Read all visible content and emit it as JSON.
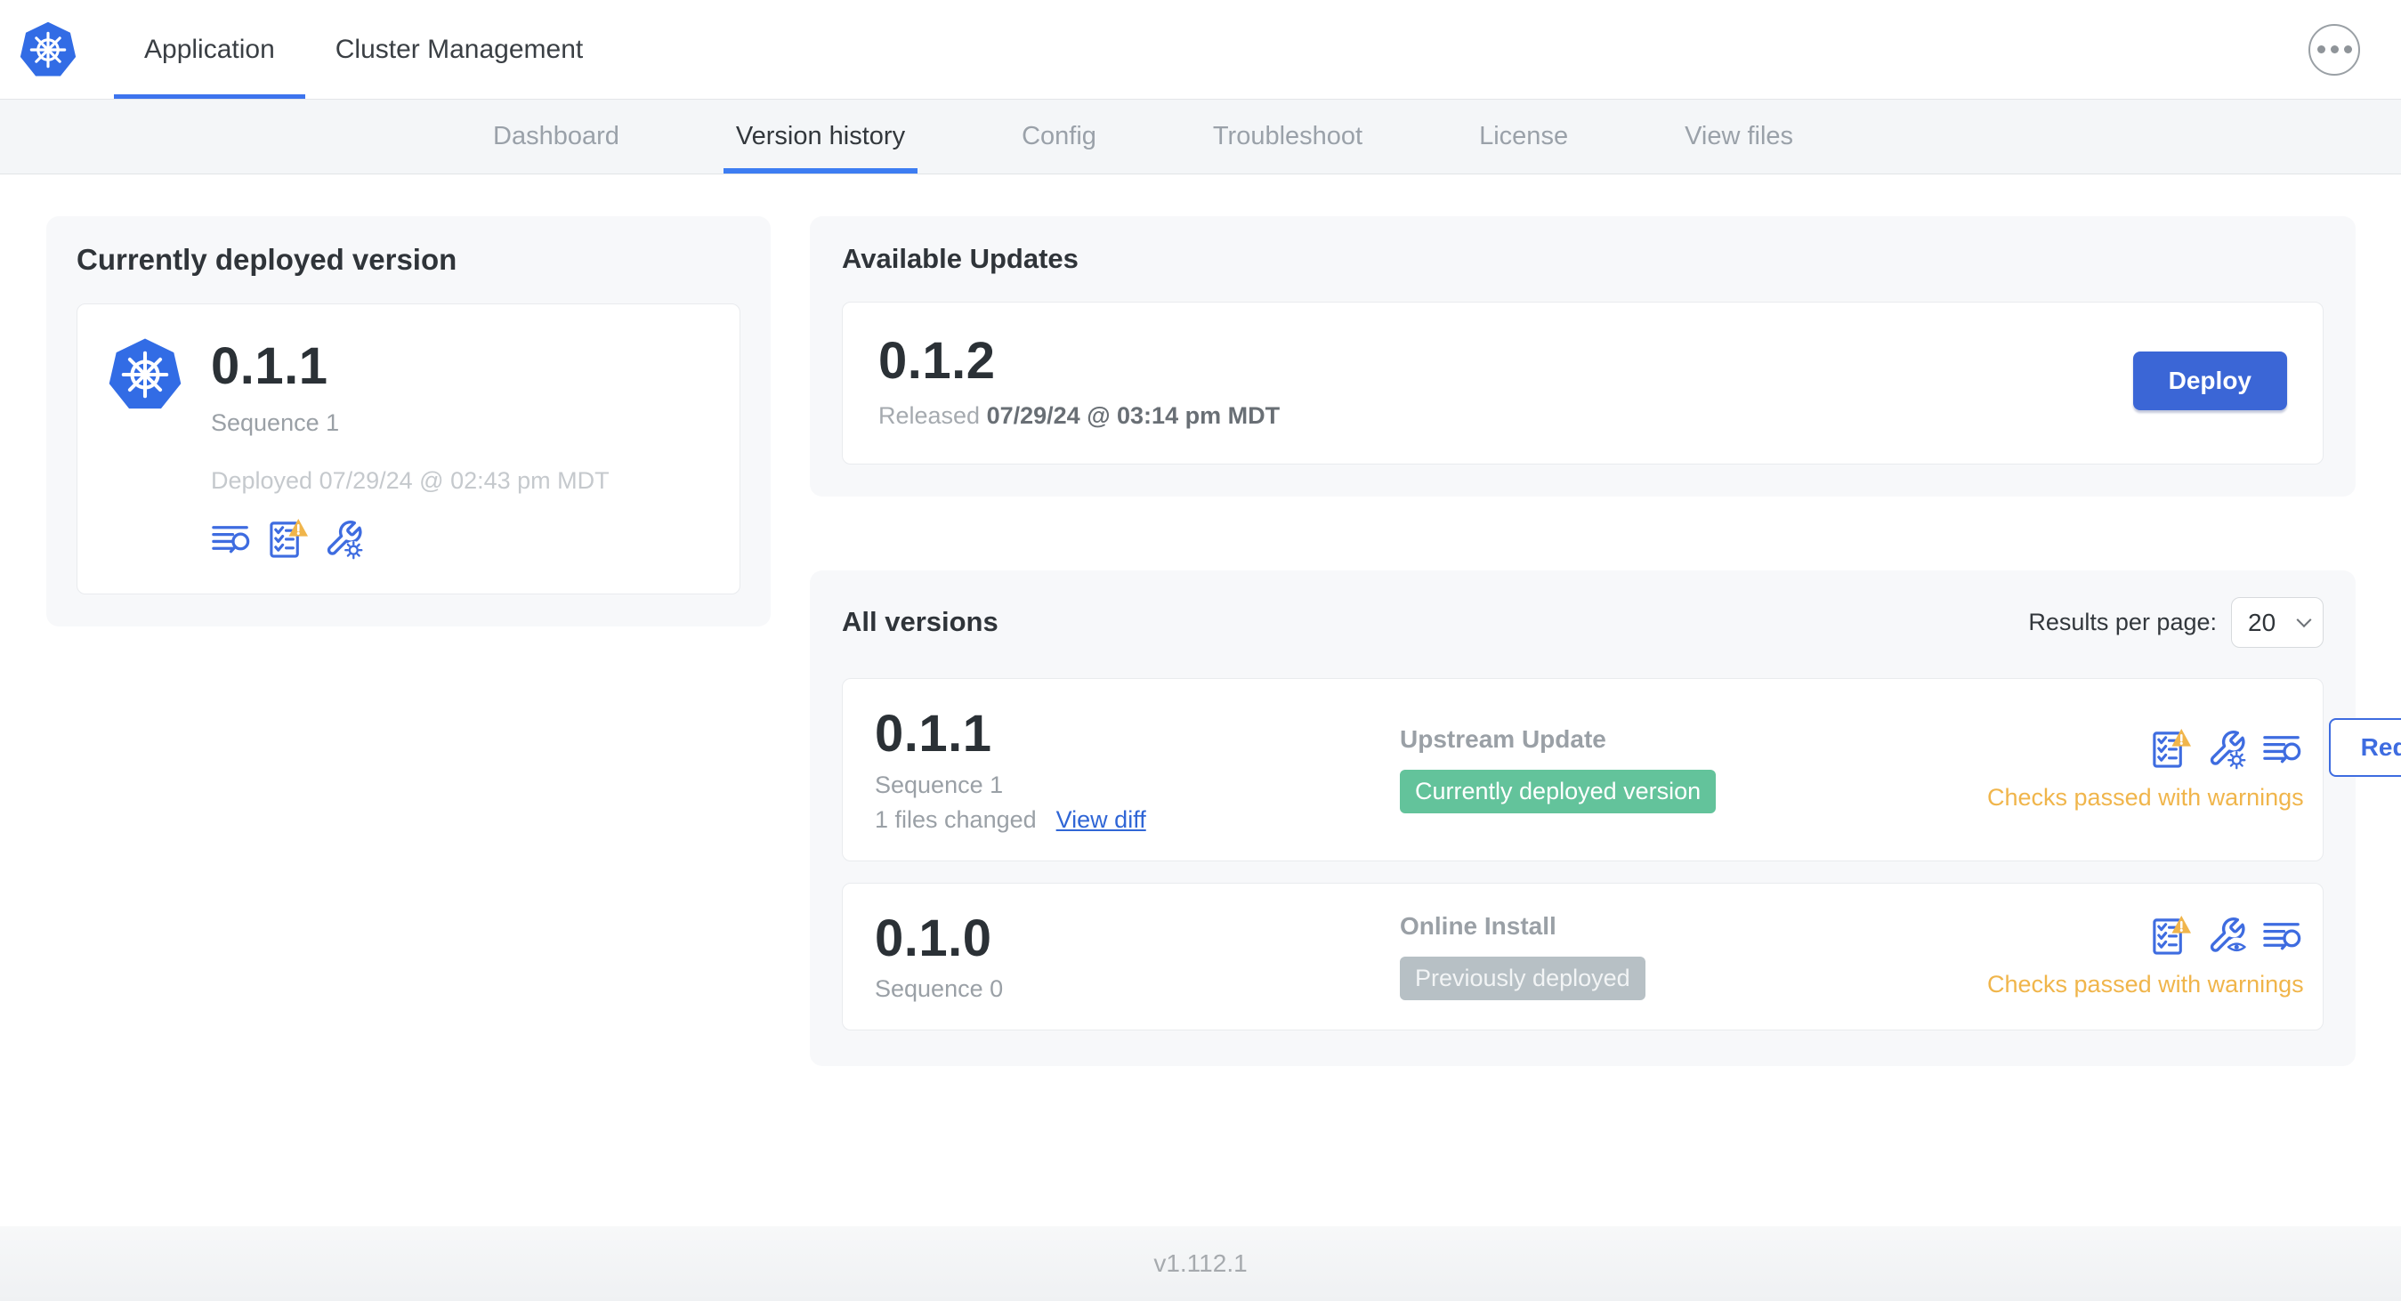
{
  "header": {
    "tabs": [
      {
        "label": "Application",
        "active": true
      },
      {
        "label": "Cluster Management",
        "active": false
      }
    ]
  },
  "subnav": {
    "tabs": [
      {
        "label": "Dashboard",
        "active": false
      },
      {
        "label": "Version history",
        "active": true
      },
      {
        "label": "Config",
        "active": false
      },
      {
        "label": "Troubleshoot",
        "active": false
      },
      {
        "label": "License",
        "active": false
      },
      {
        "label": "View files",
        "active": false
      }
    ]
  },
  "deployed_card": {
    "title": "Currently deployed version",
    "version": "0.1.1",
    "sequence": "Sequence 1",
    "deployed_at": "Deployed 07/29/24 @ 02:43 pm MDT",
    "icons": [
      "logs-search-icon",
      "preflight-checks-warning-icon",
      "config-edit-icon"
    ]
  },
  "available_updates": {
    "title": "Available Updates",
    "version": "0.1.2",
    "released_label": "Released",
    "released_at": "07/29/24 @ 03:14 pm MDT",
    "deploy_label": "Deploy"
  },
  "all_versions": {
    "title": "All versions",
    "results_per_page_label": "Results per page:",
    "results_per_page_value": "20",
    "rows": [
      {
        "version": "0.1.1",
        "sequence": "Sequence 1",
        "files_changed": "1 files changed",
        "view_diff_label": "View diff",
        "source": "Upstream Update",
        "badge_label": "Currently deployed version",
        "badge_style": "green",
        "action_label": "Redeploy",
        "status": "Checks passed with warnings",
        "icons": [
          "preflight-checks-warning-icon",
          "config-edit-icon",
          "logs-search-icon"
        ]
      },
      {
        "version": "0.1.0",
        "sequence": "Sequence 0",
        "source": "Online Install",
        "badge_label": "Previously deployed",
        "badge_style": "gray",
        "status": "Checks passed with warnings",
        "icons": [
          "preflight-checks-warning-icon",
          "config-view-icon",
          "logs-search-icon"
        ]
      }
    ]
  },
  "footer": {
    "app_version": "v1.112.1"
  },
  "colors": {
    "accent_blue": "#3e6ce0",
    "k8s_blue": "#326ce5",
    "deploy_button_blue": "#3b66d6",
    "active_tab_underline": "#3d7df2",
    "badge_green": "#63c39b",
    "badge_gray": "#b7c0c5",
    "warning_amber": "#f0b54b",
    "link_blue": "#3066d6",
    "subnav_bg": "#f4f6f8",
    "card_bg": "#f7f8fa"
  }
}
